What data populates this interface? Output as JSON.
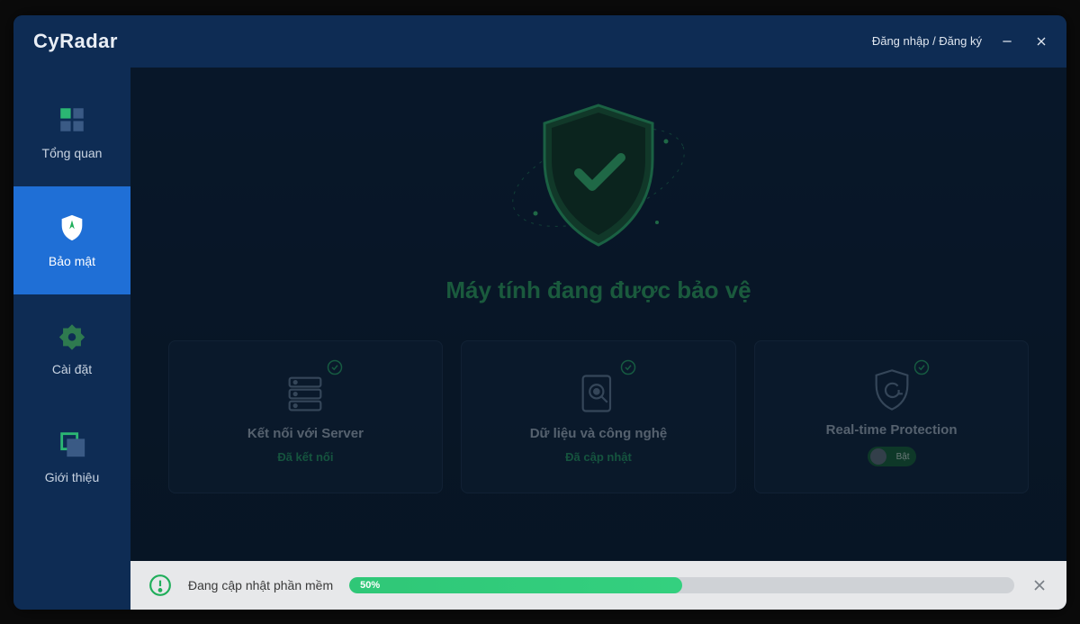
{
  "app": {
    "name": "CyRadar"
  },
  "titlebar": {
    "login_label": "Đăng nhập",
    "separator": " / ",
    "signup_label": "Đăng ký"
  },
  "sidebar": {
    "items": [
      {
        "label": "Tổng quan"
      },
      {
        "label": "Bảo mật"
      },
      {
        "label": "Cài đặt"
      },
      {
        "label": "Giới thiệu"
      }
    ],
    "active_index": 1
  },
  "main": {
    "hero_title": "Máy tính đang được bảo vệ",
    "cards": [
      {
        "title": "Kết nối với Server",
        "status": "Đã kết nối"
      },
      {
        "title": "Dữ liệu và công nghệ",
        "status": "Đã cập nhật"
      },
      {
        "title": "Real-time Protection",
        "toggle_label": "Bật"
      }
    ]
  },
  "statusbar": {
    "message": "Đang cập nhật phần mềm",
    "progress_percent": 50,
    "progress_label": "50%"
  },
  "colors": {
    "accent_blue": "#1f6fd6",
    "accent_green": "#2bb673"
  }
}
